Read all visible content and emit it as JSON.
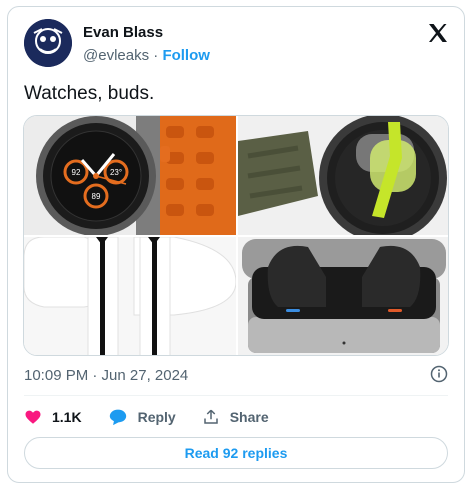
{
  "author": {
    "name": "Evan Blass",
    "handle": "@evleaks",
    "separator": "·",
    "follow_label": "Follow"
  },
  "tweet": {
    "text": "Watches, buds.",
    "timestamp": "10:09 PM · Jun 27, 2024"
  },
  "watch_face": {
    "left_number": "92",
    "right_number": "23°",
    "bottom_number": "89"
  },
  "actions": {
    "likes": "1.1K",
    "reply_label": "Reply",
    "share_label": "Share"
  },
  "read_replies": "Read 92 replies",
  "colors": {
    "accent": "#1d9bf0",
    "like": "#f91880",
    "muted": "#536471",
    "border": "#cfd9de"
  }
}
